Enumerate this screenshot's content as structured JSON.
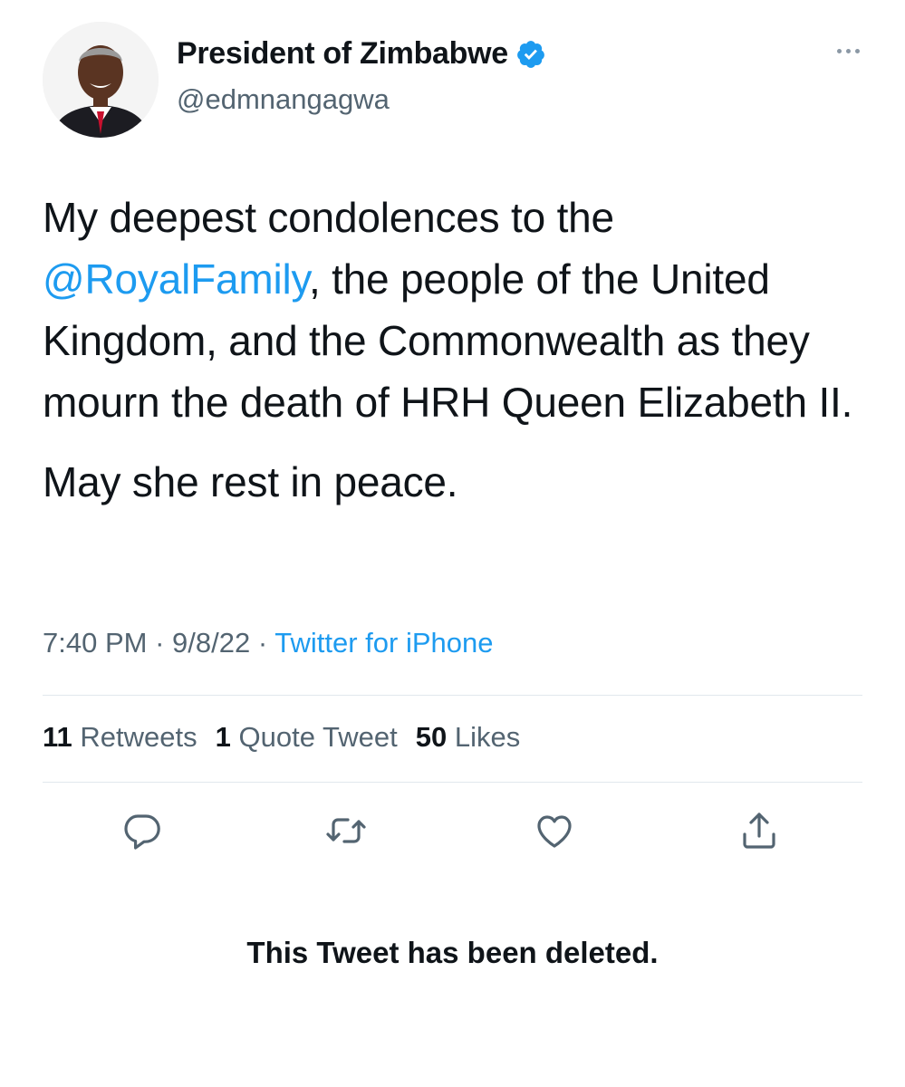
{
  "author": {
    "display_name": "President of Zimbabwe",
    "handle": "@edmnangagwa",
    "verified": true,
    "avatar_icon": "profile-photo"
  },
  "tweet": {
    "paragraph1": {
      "line1": "My deepest condolences to the",
      "mention": "@RoyalFamily",
      "after_mention": ", the people of the United Kingdom, and the Commonwealth as they mourn the death of HRH Queen Elizabeth II."
    },
    "paragraph2": "May she rest in peace.",
    "time": "7:40 PM",
    "date": "9/8/22",
    "separator": "·",
    "source": "Twitter for iPhone"
  },
  "stats": {
    "retweets_count": "11",
    "retweets_label": "Retweets",
    "quotes_count": "1",
    "quotes_label": "Quote Tweet",
    "likes_count": "50",
    "likes_label": "Likes"
  },
  "actions": [
    "reply-icon",
    "retweet-icon",
    "like-icon",
    "share-icon"
  ],
  "notice": "This Tweet has been deleted.",
  "colors": {
    "link": "#1d9bf0",
    "secondary_text": "#536471",
    "primary_text": "#0f1419",
    "verified_badge": "#1d9bf0"
  }
}
